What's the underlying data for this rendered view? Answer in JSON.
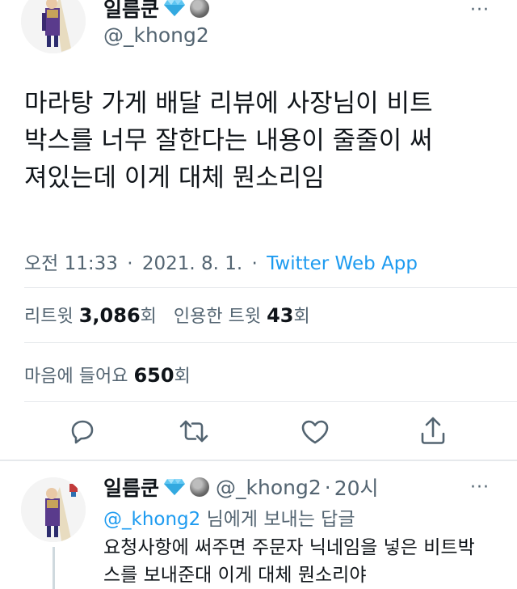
{
  "main_tweet": {
    "author_name": "일름쿤",
    "handle": "@_khong2",
    "more": "···",
    "text_lines": [
      "마라탕 가게 배달 리뷰에 사장님이 비트",
      "박스를 너무 잘한다는 내용이 줄줄이 써",
      "져있는데 이게 대체 뭔소리임"
    ],
    "time": "오전 11:33",
    "date": "2021. 8. 1.",
    "separator": "·",
    "source": "Twitter Web App",
    "retweets_label": "리트윗",
    "retweets_count": "3,086",
    "retweets_suffix": "회",
    "quotes_label": "인용한 트윗",
    "quotes_count": "43",
    "quotes_suffix": "회",
    "likes_label": "마음에 들어요",
    "likes_count": "650",
    "likes_suffix": "회"
  },
  "reply_tweet": {
    "author_name": "일름쿤",
    "handle": "@_khong2",
    "time_ago": "20시",
    "separator": "·",
    "more": "···",
    "replying_to_handle": "@_khong2",
    "replying_to_suffix": "님에게 보내는 답글",
    "text_lines": [
      "요청사항에 써주면 주문자 닉네임을 넣은 비트박",
      "스를 보내준대 이게 대체 뭔소리야"
    ]
  },
  "icons": [
    "reply-icon",
    "retweet-icon",
    "like-icon",
    "share-icon",
    "diamond-badge-icon",
    "moon-badge-icon",
    "more-icon"
  ],
  "colors": {
    "link": "#1d9bf0",
    "secondary": "#536471",
    "text": "#0f1419",
    "divider": "#e6e9ec"
  }
}
